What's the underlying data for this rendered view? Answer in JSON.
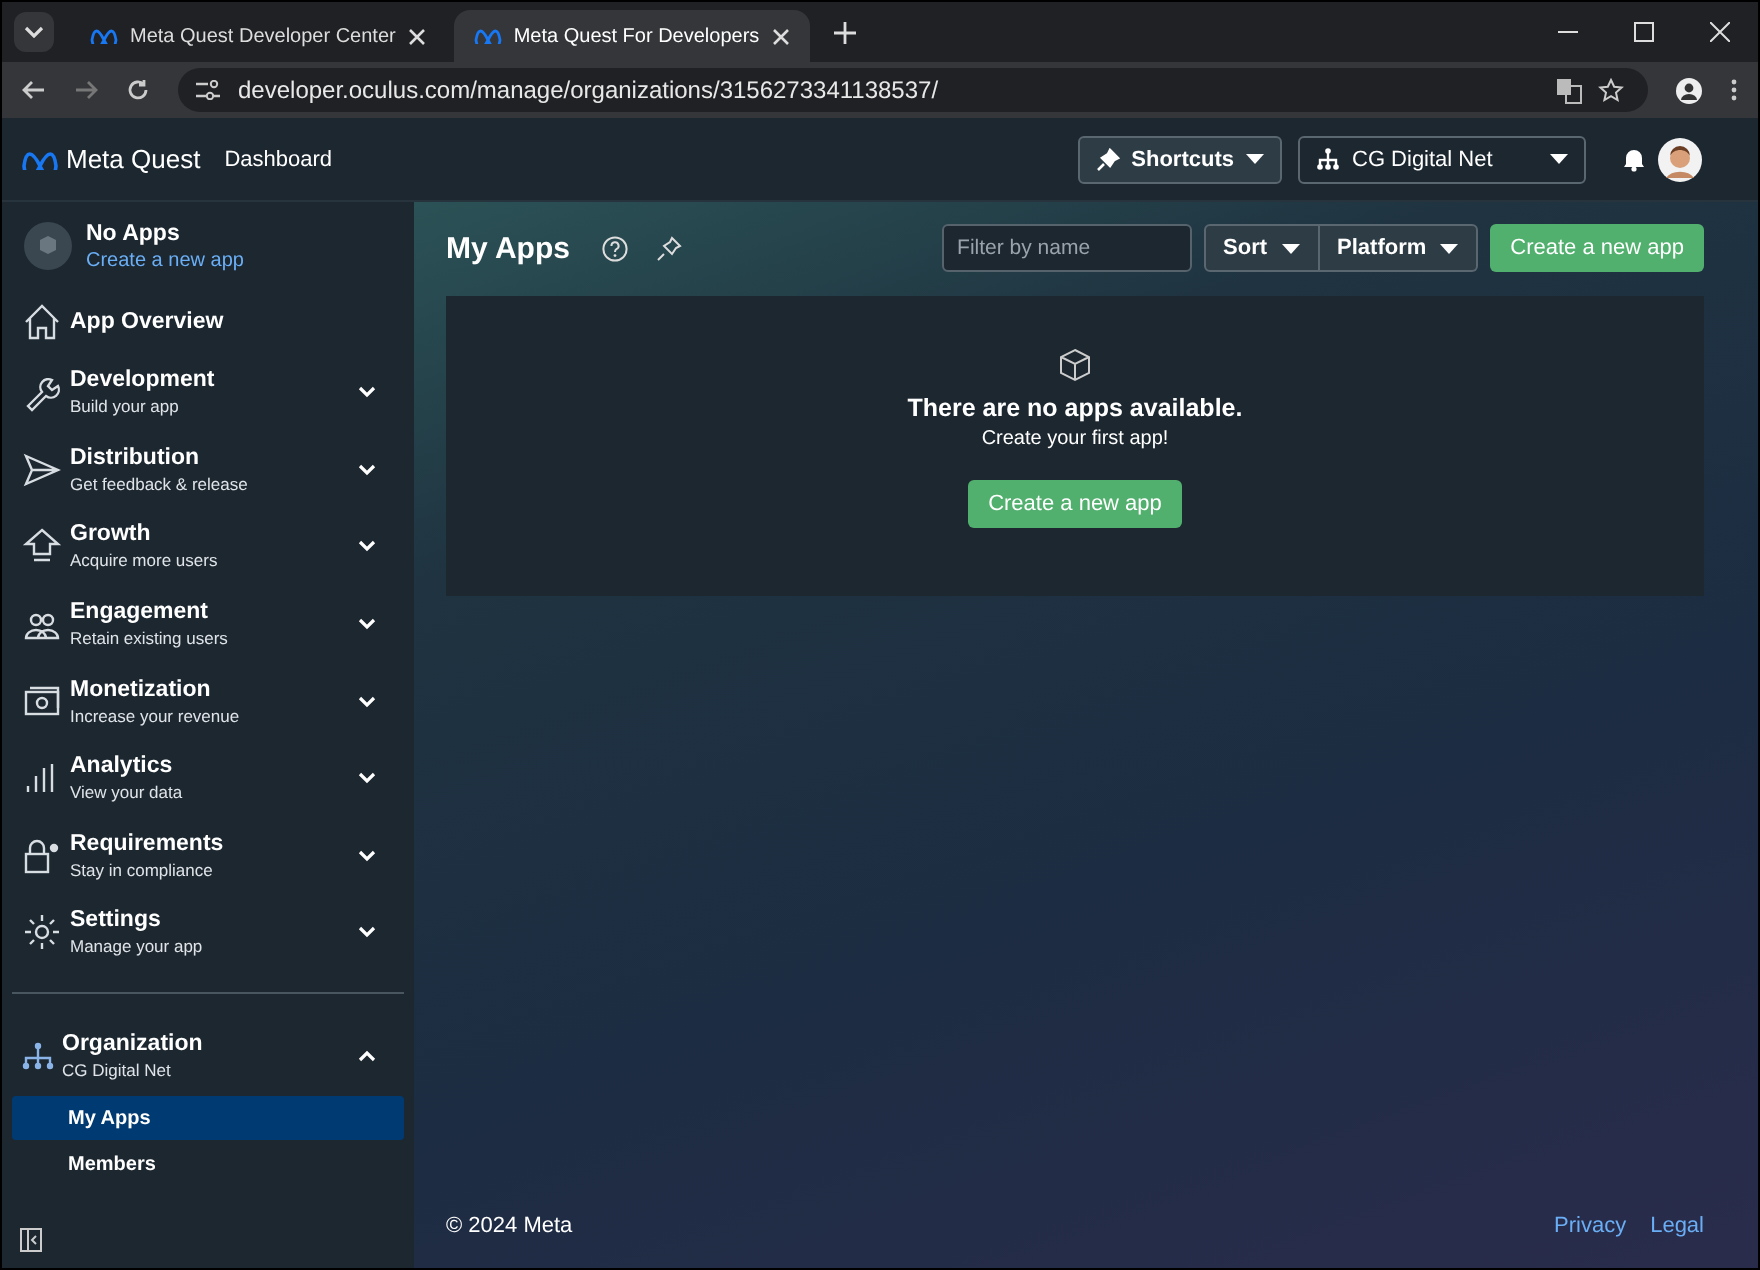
{
  "browser": {
    "tabs": [
      {
        "title": "Meta Quest Developer Center",
        "selected": false
      },
      {
        "title": "Meta Quest For Developers",
        "selected": true
      }
    ],
    "url": "developer.oculus.com/manage/organizations/3156273341138537/"
  },
  "header": {
    "brand": "Meta Quest",
    "section": "Dashboard",
    "shortcuts": "Shortcuts",
    "org_selector": "CG Digital Net"
  },
  "sidebar": {
    "app": {
      "title": "No Apps",
      "link": "Create a new app"
    },
    "items": [
      {
        "kind": "link",
        "title": "App Overview"
      },
      {
        "kind": "group",
        "title": "Development",
        "subtitle": "Build your app",
        "expanded": false
      },
      {
        "kind": "group",
        "title": "Distribution",
        "subtitle": "Get feedback & release",
        "expanded": false
      },
      {
        "kind": "group",
        "title": "Growth",
        "subtitle": "Acquire more users",
        "expanded": false
      },
      {
        "kind": "group",
        "title": "Engagement",
        "subtitle": "Retain existing users",
        "expanded": false
      },
      {
        "kind": "group",
        "title": "Monetization",
        "subtitle": "Increase your revenue",
        "expanded": false
      },
      {
        "kind": "group",
        "title": "Analytics",
        "subtitle": "View your data",
        "expanded": false
      },
      {
        "kind": "group",
        "title": "Requirements",
        "subtitle": "Stay in compliance",
        "expanded": false
      },
      {
        "kind": "group",
        "title": "Settings",
        "subtitle": "Manage your app",
        "expanded": false
      }
    ],
    "organization": {
      "title": "Organization",
      "subtitle": "CG Digital Net",
      "expanded": true,
      "children": [
        {
          "label": "My Apps",
          "selected": true
        },
        {
          "label": "Members",
          "selected": false
        }
      ]
    }
  },
  "main": {
    "title": "My Apps",
    "filter": {
      "placeholder": "Filter by name"
    },
    "sort": "Sort",
    "platform": "Platform",
    "create_button": "Create a new app",
    "empty": {
      "heading": "There are no apps available.",
      "text": "Create your first app!",
      "button": "Create a new app"
    }
  },
  "footer": {
    "copyright": "© 2024 Meta",
    "links": [
      "Privacy",
      "Legal"
    ]
  }
}
